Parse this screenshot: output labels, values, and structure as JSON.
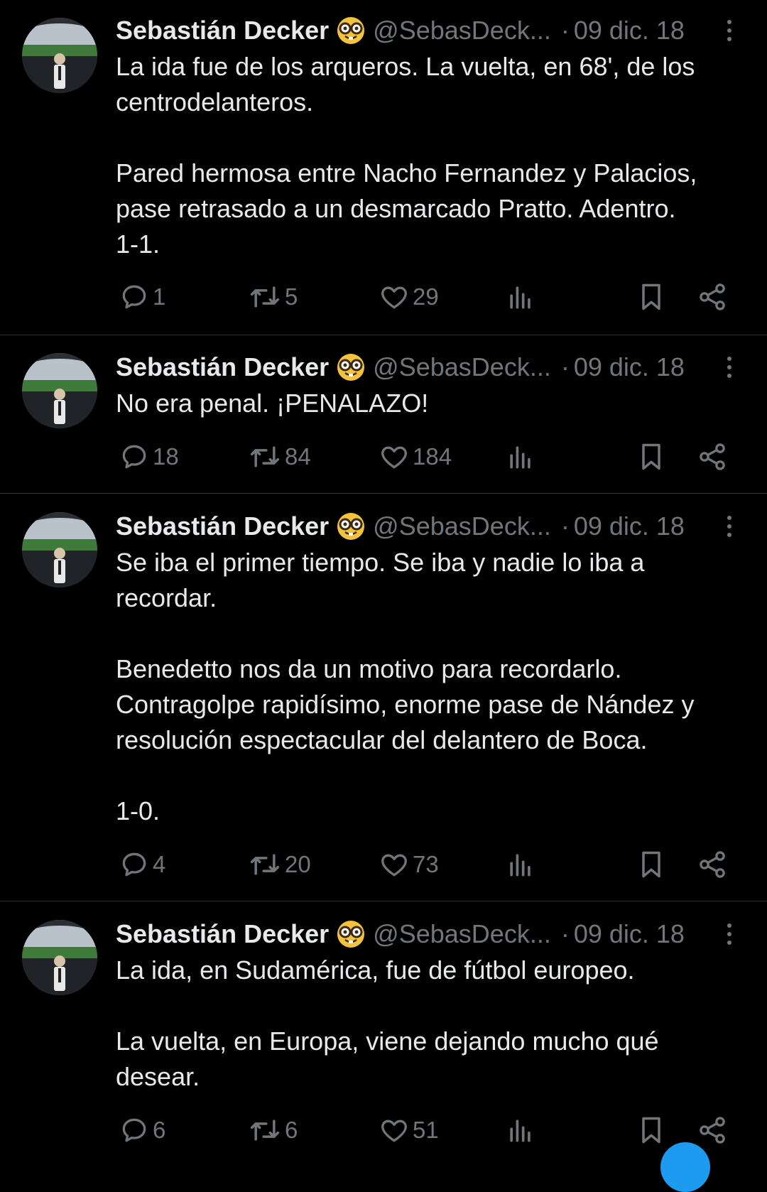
{
  "author": {
    "name": "Sebastián Decker",
    "handle": "@SebasDeck...",
    "emoji": "nerd-face-emoji"
  },
  "colors": {
    "background": "#000000",
    "text": "#e7e9ea",
    "muted": "#71767b",
    "divider": "#2f3336",
    "accent": "#1d9bf0"
  },
  "tweets": [
    {
      "date": "09 dic. 18",
      "text": "La ida fue de los arqueros. La vuelta, en 68', de los centrodelanteros.\n\nPared hermosa entre Nacho Fernandez y Palacios, pase retrasado a un desmarcado Pratto. Adentro.\n1-1.",
      "replies": "1",
      "retweets": "5",
      "likes": "29"
    },
    {
      "date": "09 dic. 18",
      "text": "No era penal. ¡PENALAZO!",
      "replies": "18",
      "retweets": "84",
      "likes": "184"
    },
    {
      "date": "09 dic. 18",
      "text": "Se iba el primer tiempo. Se iba y nadie lo iba a recordar.\n\nBenedetto nos da un motivo para recordarlo. Contragolpe rapidísimo, enorme pase de Nández y resolución espectacular del delantero de Boca.\n\n1-0.",
      "replies": "4",
      "retweets": "20",
      "likes": "73"
    },
    {
      "date": "09 dic. 18",
      "text": "La ida, en Sudamérica, fue de fútbol europeo.\n\nLa vuelta, en Europa, viene dejando mucho qué desear.",
      "replies": "6",
      "retweets": "6",
      "likes": "51"
    }
  ]
}
